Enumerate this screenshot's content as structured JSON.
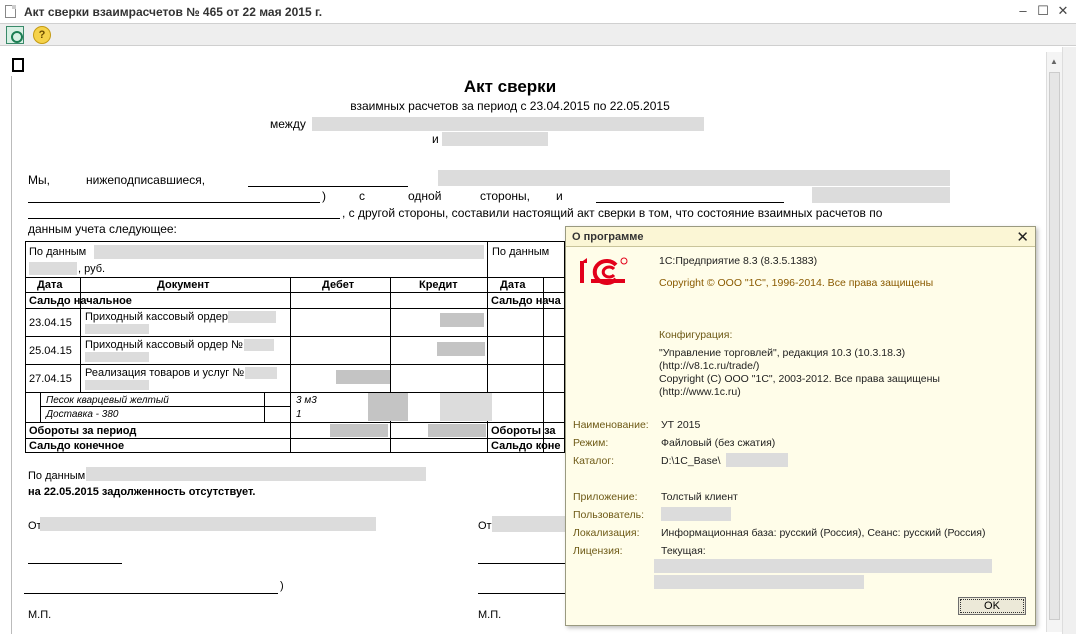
{
  "window": {
    "title": "Акт сверки взаимрасчетов № 465 от 22 мая 2015 г."
  },
  "toolbar": {
    "help_label": "?"
  },
  "document": {
    "heading": "Акт сверки",
    "subheading": "взаимных расчетов за период с 23.04.2015 по 22.05.2015",
    "between_label": "между",
    "and_label": "и",
    "para_we": "Мы,",
    "para_undersigned": "нижеподписавшиеся,",
    "para_c": "с",
    "para_one": "одной",
    "para_side": "стороны,",
    "para_and": "и",
    "para_line3": ", с другой стороны, составили настоящий акт сверки в том, что состояние взаимных расчетов по",
    "para_line4": "данным учета следующее:",
    "table": {
      "by_data_left": "По данным",
      "rub_label": ", руб.",
      "by_data_right": "По данным",
      "col_date": "Дата",
      "col_document": "Документ",
      "col_debit": "Дебет",
      "col_credit": "Кредит",
      "col_date_right": "Дата",
      "saldo_start": "Сальдо начальное",
      "saldo_start_right": "Сальдо нача",
      "rows": [
        {
          "date": "23.04.15",
          "doc": "Приходный кассовый ордер"
        },
        {
          "date": "25.04.15",
          "doc": "Приходный кассовый ордер №"
        },
        {
          "date": "27.04.15",
          "doc": "Реализация товаров и услуг №"
        }
      ],
      "goods": [
        {
          "name": "Песок кварцевый желтый",
          "qty": "3 м3"
        },
        {
          "name": "Доставка - 380",
          "qty": "1"
        }
      ],
      "turnover": "Обороты за период",
      "turnover_right": "Обороты за",
      "saldo_end": "Сальдо конечное",
      "saldo_end_right": "Сальдо коне"
    },
    "footer_by_data": "По данным",
    "footer_statement": "на 22.05.2015 задолженность отсутствует.",
    "from_left": "От",
    "from_right": "От",
    "sign_paren": ")",
    "mp_left": "М.П.",
    "mp_right": "М.П."
  },
  "about": {
    "title": "О программе",
    "close": "✕",
    "product": "1С:Предприятие 8.3 (8.3.5.1383)",
    "copyright": "Copyright © ООО \"1С\", 1996-2014. Все права защищены",
    "config_label": "Конфигурация:",
    "config_line1": "\"Управление торговлей\", редакция 10.3 (10.3.18.3)",
    "config_line2": "(http://v8.1c.ru/trade/)",
    "config_line3": "Copyright (С) ООО \"1С\", 2003-2012. Все права защищены",
    "config_line4": "(http://www.1c.ru)",
    "name_label": "Наименование:",
    "name_value": "УТ 2015",
    "mode_label": "Режим:",
    "mode_value": "Файловый (без сжатия)",
    "catalog_label": "Каталог:",
    "catalog_value": "D:\\1C_Base\\",
    "app_label": "Приложение:",
    "app_value": "Толстый клиент",
    "user_label": "Пользователь:",
    "locale_label": "Локализация:",
    "locale_value": "Информационная база: русский (Россия), Сеанс: русский (Россия)",
    "license_label": "Лицензия:",
    "license_value": "Текущая:",
    "ok_label": "OK",
    "brand_color": "#e2001a",
    "accent_color": "#8a5a00"
  }
}
